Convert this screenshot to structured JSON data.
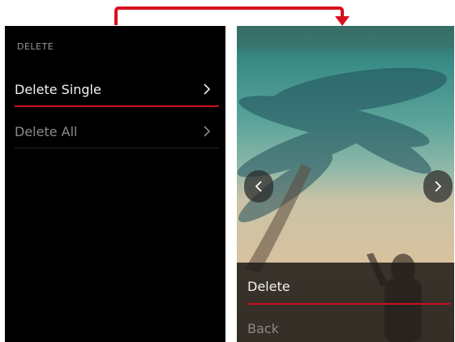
{
  "left_menu": {
    "header": "DELETE",
    "items": [
      {
        "label": "Delete Single",
        "icon": "chevron-right-icon",
        "state": "selected"
      },
      {
        "label": "Delete All",
        "icon": "chevron-right-icon",
        "state": "normal"
      }
    ]
  },
  "photo_view": {
    "prev_icon": "chevron-left-icon",
    "next_icon": "chevron-right-icon",
    "menu": {
      "delete_label": "Delete",
      "back_label": "Back"
    }
  },
  "colors": {
    "accent_red": "#c8101e",
    "panel_bg": "#000000",
    "text_active": "#f2f2f2",
    "text_inactive": "#8a8a8a"
  }
}
